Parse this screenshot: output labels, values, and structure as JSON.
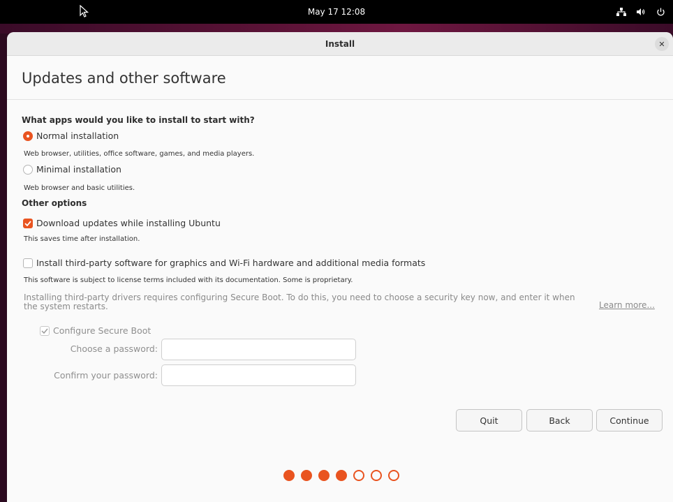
{
  "topbar": {
    "clock": "May 17  12:08"
  },
  "window": {
    "title": "Install"
  },
  "page": {
    "title": "Updates and other software"
  },
  "apps": {
    "heading": "What apps would you like to install to start with?",
    "normal": {
      "label": "Normal installation",
      "desc": "Web browser, utilities, office software, games, and media players.",
      "selected": true
    },
    "minimal": {
      "label": "Minimal installation",
      "desc": "Web browser and basic utilities.",
      "selected": false
    }
  },
  "other": {
    "heading": "Other options",
    "updates": {
      "label": "Download updates while installing Ubuntu",
      "desc": "This saves time after installation.",
      "checked": true
    },
    "thirdparty": {
      "label": "Install third-party software for graphics and Wi-Fi hardware and additional media formats",
      "desc": "This software is subject to license terms included with its documentation. Some is proprietary.",
      "checked": false
    },
    "secureboot_info": "Installing third-party drivers requires configuring Secure Boot. To do this, you need to choose a security key now, and enter it when the system restarts.",
    "learn_more": "Learn more...",
    "configure_secure_boot": "Configure Secure Boot",
    "password_label": "Choose a password:",
    "confirm_label": "Confirm your password:"
  },
  "buttons": {
    "quit": "Quit",
    "back": "Back",
    "continue": "Continue"
  },
  "progress": {
    "completed_steps": 4,
    "total_steps": 7
  },
  "colors": {
    "accent": "#e95420"
  }
}
